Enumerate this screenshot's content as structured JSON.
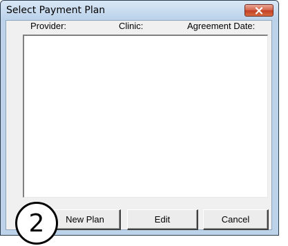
{
  "window": {
    "title": "Select Payment Plan",
    "close_icon": "close-x-icon"
  },
  "list": {
    "columns": [
      "Provider:",
      "Clinic:",
      "Agreement Date:"
    ],
    "rows": []
  },
  "buttons": {
    "new_plan": "New Plan",
    "edit": "Edit",
    "cancel": "Cancel"
  },
  "callout": {
    "step_number": "2"
  },
  "colors": {
    "title_bar": "#bcd3ea",
    "close_button": "#c13f24",
    "client_background": "#f0f0f0"
  }
}
